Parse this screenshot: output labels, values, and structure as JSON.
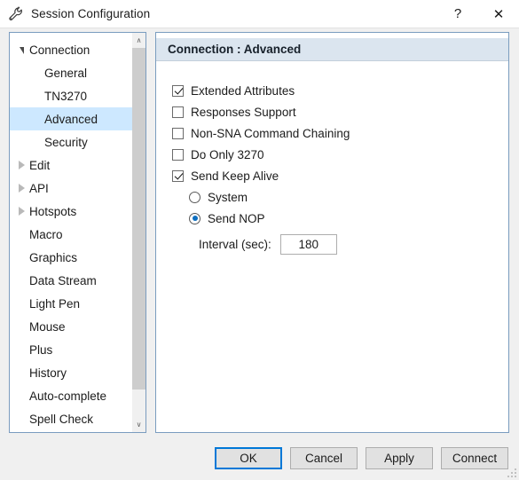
{
  "window": {
    "title": "Session Configuration",
    "icon": "wrench-icon",
    "help_label": "?",
    "close_label": "✕"
  },
  "sidebar": {
    "scroll_up_label": "∧",
    "scroll_down_label": "∨",
    "items": [
      {
        "label": "Connection",
        "level": 0,
        "twisty": "expanded",
        "selected": false
      },
      {
        "label": "General",
        "level": 1,
        "twisty": "none",
        "selected": false
      },
      {
        "label": "TN3270",
        "level": 1,
        "twisty": "none",
        "selected": false
      },
      {
        "label": "Advanced",
        "level": 1,
        "twisty": "none",
        "selected": true
      },
      {
        "label": "Security",
        "level": 1,
        "twisty": "none",
        "selected": false
      },
      {
        "label": "Edit",
        "level": 0,
        "twisty": "collapsed",
        "selected": false
      },
      {
        "label": "API",
        "level": 0,
        "twisty": "collapsed",
        "selected": false
      },
      {
        "label": "Hotspots",
        "level": 0,
        "twisty": "collapsed",
        "selected": false
      },
      {
        "label": "Macro",
        "level": 0,
        "twisty": "none",
        "selected": false
      },
      {
        "label": "Graphics",
        "level": 0,
        "twisty": "none",
        "selected": false
      },
      {
        "label": "Data Stream",
        "level": 0,
        "twisty": "none",
        "selected": false
      },
      {
        "label": "Light Pen",
        "level": 0,
        "twisty": "none",
        "selected": false
      },
      {
        "label": "Mouse",
        "level": 0,
        "twisty": "none",
        "selected": false
      },
      {
        "label": "Plus",
        "level": 0,
        "twisty": "none",
        "selected": false
      },
      {
        "label": "History",
        "level": 0,
        "twisty": "none",
        "selected": false
      },
      {
        "label": "Auto-complete",
        "level": 0,
        "twisty": "none",
        "selected": false
      },
      {
        "label": "Spell Check",
        "level": 0,
        "twisty": "none",
        "selected": false
      }
    ]
  },
  "content": {
    "header_title": "Connection : Advanced",
    "checkboxes": [
      {
        "label": "Extended Attributes",
        "checked": true
      },
      {
        "label": "Responses Support",
        "checked": false
      },
      {
        "label": "Non-SNA Command Chaining",
        "checked": false
      },
      {
        "label": "Do Only 3270",
        "checked": false
      },
      {
        "label": "Send Keep Alive",
        "checked": true
      }
    ],
    "radios": [
      {
        "label": "System",
        "selected": false
      },
      {
        "label": "Send NOP",
        "selected": true
      }
    ],
    "interval": {
      "label": "Interval (sec):",
      "value": "180"
    }
  },
  "footer": {
    "buttons": [
      {
        "label": "OK",
        "default": true
      },
      {
        "label": "Cancel",
        "default": false
      },
      {
        "label": "Apply",
        "default": false
      },
      {
        "label": "Connect",
        "default": false
      }
    ]
  },
  "colors": {
    "accent": "#0078d7",
    "selection": "#cde8ff",
    "header_band": "#dbe5ef",
    "panel_border": "#7a9cbf",
    "radio_dot": "#0d6ebf"
  }
}
